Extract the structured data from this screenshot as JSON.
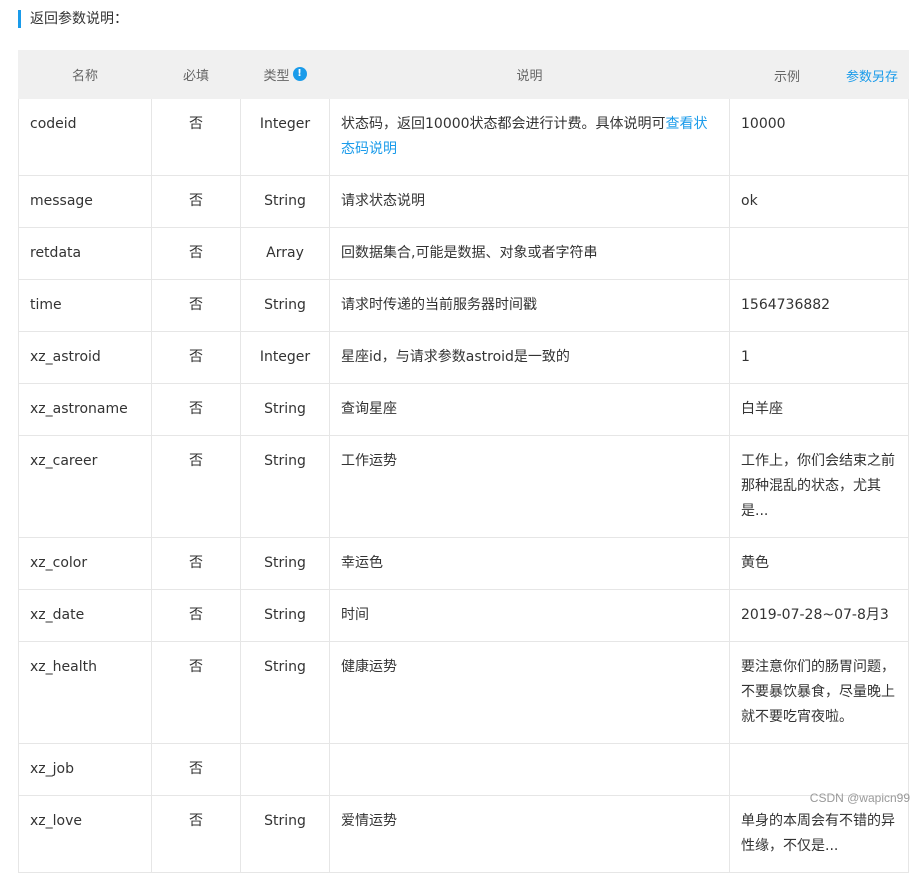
{
  "section": {
    "title": "返回参数说明："
  },
  "header": {
    "name": "名称",
    "required": "必填",
    "type": "类型",
    "info_icon": "!",
    "description": "说明",
    "example": "示例",
    "save_link": "参数另存"
  },
  "rows": [
    {
      "name": "codeid",
      "required": "否",
      "type": "Integer",
      "desc": "状态码，返回10000状态都会进行计费。具体说明可",
      "desc_link": "查看状态码说明",
      "example": "10000"
    },
    {
      "name": "message",
      "required": "否",
      "type": "String",
      "desc": "请求状态说明",
      "example": "ok"
    },
    {
      "name": "retdata",
      "required": "否",
      "type": "Array",
      "desc": "回数据集合,可能是数据、对象或者字符串",
      "example": ""
    },
    {
      "name": "time",
      "required": "否",
      "type": "String",
      "desc": "请求时传递的当前服务器时间戳",
      "example": "1564736882"
    },
    {
      "name": "xz_astroid",
      "required": "否",
      "type": "Integer",
      "desc": "星座id，与请求参数astroid是一致的",
      "example": "1"
    },
    {
      "name": "xz_astroname",
      "required": "否",
      "type": "String",
      "desc": "查询星座",
      "example": "白羊座"
    },
    {
      "name": "xz_career",
      "required": "否",
      "type": "String",
      "desc": "工作运势",
      "example": "工作上，你们会结束之前那种混乱的状态，尤其是..."
    },
    {
      "name": "xz_color",
      "required": "否",
      "type": "String",
      "desc": "幸运色",
      "example": "黄色"
    },
    {
      "name": "xz_date",
      "required": "否",
      "type": "String",
      "desc": "时间",
      "example": "2019-07-28~07-8月3"
    },
    {
      "name": "xz_health",
      "required": "否",
      "type": "String",
      "desc": "健康运势",
      "example": "要注意你们的肠胃问题，不要暴饮暴食，尽量晚上就不要吃宵夜啦。"
    },
    {
      "name": "xz_job",
      "required": "否",
      "type": "",
      "desc": "",
      "example": ""
    },
    {
      "name": "xz_love",
      "required": "否",
      "type": "String",
      "desc": "爱情运势",
      "example": "单身的本周会有不错的异性缘，不仅是..."
    }
  ],
  "watermark": "CSDN @wapicn99"
}
